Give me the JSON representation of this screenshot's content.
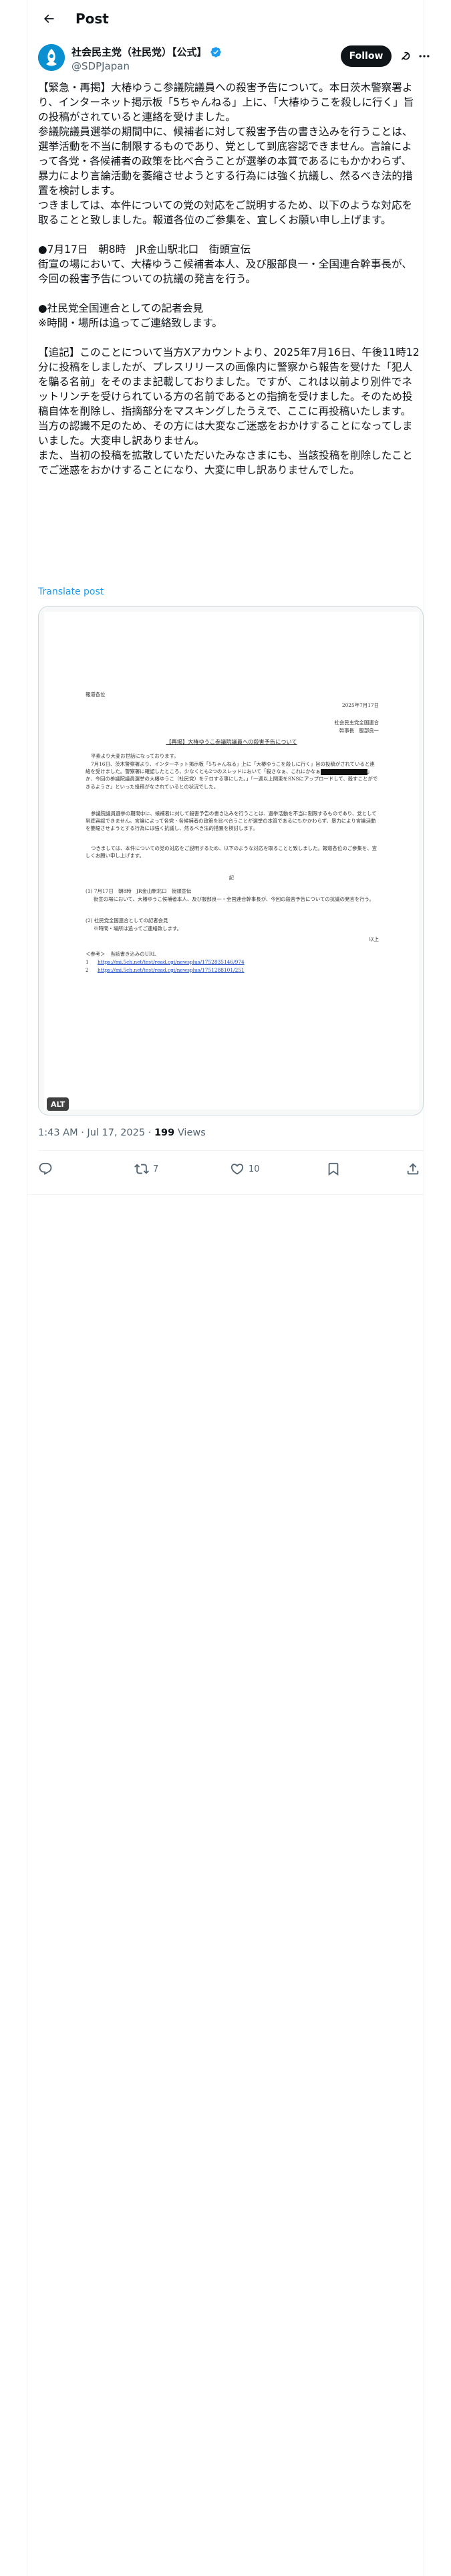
{
  "header": {
    "title": "Post"
  },
  "author": {
    "display_name": "社会民主党（社民党）【公式】",
    "handle": "@SDPJapan",
    "follow_label": "Follow",
    "verified_color": "#1d9bf0"
  },
  "post": {
    "paragraphs": [
      "【緊急・再掲】大椿ゆうこ参議院議員への殺害予告について。本日茨木警察署より、インターネット掲示板「5ちゃんねる」上に、「大椿ゆうこを殺しに行く」旨の投稿がされていると連絡を受けました。",
      "参議院議員選挙の期間中に、候補者に対して殺害予告の書き込みを行うことは、選挙活動を不当に制限するものであり、党として到底容認できません。言論によって各党・各候補者の政策を比べ合うことが選挙の本質であるにもかかわらず、暴力により言論活動を萎縮させようとする行為には強く抗議し、然るべき法的措置を検討します。",
      "つきましては、本件についての党の対応をご説明するため、以下のような対応を取ることと致しました。報道各位のご参集を、宜しくお願い申し上げます。",
      "",
      "●7月17日　朝8時　JR金山駅北口　街頭宣伝",
      "街宣の場において、大椿ゆうこ候補者本人、及び服部良一・全国連合幹事長が、今回の殺害予告についての抗議の発言を行う。",
      "",
      "●社民党全国連合としての記者会見",
      "※時間・場所は追ってご連絡致します。",
      "",
      "【追記】このことについて当方Xアカウントより、2025年7月16日、午後11時12分に投稿をしましたが、プレスリリースの画像内に警察から報告を受けた「犯人を騙る名前」をそのまま記載しておりました。ですが、これは以前より別件でネットリンチを受けられている方の名前であるとの指摘を受けました。そのため投稿自体を削除し、指摘部分をマスキングしたうえで、ここに再投稿いたします。",
      "当方の認識不足のため、その方には大変なご迷惑をおかけすることになってしまいました。大変申し訳ありません。",
      "また、当初の投稿を拡散していただいたみなさまにも、当該投稿を削除したことでご迷惑をおかけすることになり、大変に申し訳ありませんでした。"
    ],
    "translate_label": "Translate post",
    "timestamp": "1:43 AM · Jul 17, 2025 · ",
    "views_count": "199",
    "views_label": " Views"
  },
  "document": {
    "to": "報道各位",
    "date": "2025年7月17日",
    "org": "社会民主党全国連合",
    "signer": "幹事長　服部良一",
    "title": "【再掲】大椿ゆうこ参議院議員への殺害予告について",
    "greeting": "平素より大変お世話になっております。",
    "body1a": "7月16日、茨木警察署より、インターネット掲示板「5ちゃんねる」上に「大椿ゆうこを殺しに行く」旨の投稿がされていると連絡を受けました。警察署に確認したところ、少なくとも2つのスレッドにおいて「殺さなぁ、これにかなぁ",
    "body1b": "」か、",
    "body1c": "今回の参議院議員選挙の大椿ゆうこ（社民党）をテロする事にした。」「一週以上関東をSNSにアップロードして、殺すことができるようさ」といった投稿がなされているとの状況でした。",
    "body2": "参議院議員選挙の期間中に、候補者に対して殺害予告の書き込みを行うことは、選挙活動を不当に制限するものであり、党として到底容認できません。言論によって各党・各候補者の政策を比べ合うことが選挙の本質であるにもかかわらず、暴力により言論活動を萎縮させようとする行為には強く抗議し、然るべき法的措置を検討します。",
    "body3": "つきましては、本件についての党の対応をご説明するため、以下のような対応を取ることと致しました。報道各位のご参集を、宜しくお願い申し上げます。",
    "ki": "記",
    "item1": "(1) 7月17日　朝8時　JR金山駅北口　街頭宣伝",
    "item1b": "街宣の場において、大椿ゆうこ候補者本人、及び服部良一・全国連合幹事長が、今回の殺害予告についての抗議の発言を行う。",
    "item2": "(2) 社民党全国連合としての記者会見",
    "item2b": "※時間・場所は追ってご連絡致します。",
    "end": "以上",
    "ref_title": "＜参考＞　当該書き込みのURL",
    "ref1_num": "1",
    "ref1": "https://mi.5ch.net/test/read.cgi/newsplus/1752835146/974",
    "ref2_num": "2",
    "ref2": "https://mi.5ch.net/test/read.cgi/newsplus/1751288101/251",
    "alt_label": "ALT"
  },
  "actions": {
    "reply_count": "",
    "repost_count": "7",
    "like_count": "10",
    "bookmark_count": "",
    "accent_gray": "#536471"
  }
}
